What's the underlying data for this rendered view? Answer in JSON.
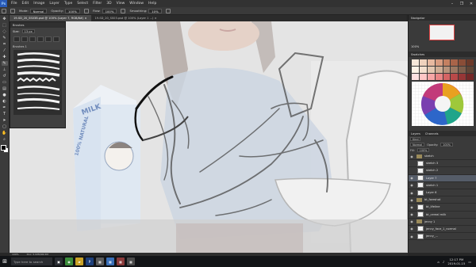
{
  "app": {
    "menu": [
      "File",
      "Edit",
      "Image",
      "Layer",
      "Type",
      "Select",
      "Filter",
      "3D",
      "View",
      "Window",
      "Help"
    ],
    "window_controls": [
      "–",
      "❐",
      "✕"
    ]
  },
  "options_bar": {
    "mode_label": "Mode:",
    "mode_value": "Normal",
    "opacity_label": "Opacity:",
    "opacity_value": "100%",
    "flow_label": "Flow:",
    "flow_value": "100%",
    "smoothing_label": "Smoothing:",
    "smoothing_value": "10%"
  },
  "tabs": [
    {
      "label": "19-SD_20_SS03B.psd @ 100% (Layer 7, RGB/8#) ×",
      "active": true
    },
    {
      "label": "19-SD_20_SS03.psd @ 100% (Layer 1 ...) ×",
      "active": false
    }
  ],
  "brush_panel": {
    "title": "Brushes",
    "size_label": "Size:",
    "size_value": "13 px",
    "group_label": "Brushes 1"
  },
  "navigator": {
    "title": "Navigator",
    "zoom": "100%"
  },
  "swatches": {
    "title": "Swatches",
    "colors": [
      "#f6e7d9",
      "#efd2bd",
      "#e7b9a0",
      "#d89c80",
      "#c48061",
      "#a96449",
      "#8a4d37",
      "#6c3a2a",
      "#fff2e6",
      "#f3dfce",
      "#e3c7b0",
      "#cfae95",
      "#b8937b",
      "#9c7862",
      "#7e5f4c",
      "#614636",
      "#ffe0e0",
      "#ffc6c6",
      "#f7a6a6",
      "#e98585",
      "#d56464",
      "#b94949",
      "#973636",
      "#742828"
    ]
  },
  "layers": {
    "tabs": [
      "Layers",
      "Channels"
    ],
    "kind_label": "Kind",
    "blend_mode": "Normal",
    "opacity_label": "Opacity:",
    "opacity_value": "100%",
    "fill_label": "Fill:",
    "fill_value": "100%",
    "rows": [
      {
        "name": "sketch",
        "type": "folder",
        "visible": true,
        "selected": false
      },
      {
        "name": "sketch 3",
        "type": "layer",
        "visible": false,
        "selected": false
      },
      {
        "name": "sketch 2",
        "type": "layer",
        "visible": false,
        "selected": false
      },
      {
        "name": "Layer 7",
        "type": "layer",
        "visible": true,
        "selected": true
      },
      {
        "name": "sketch 1",
        "type": "layer",
        "visible": true,
        "selected": false
      },
      {
        "name": "Layer 6",
        "type": "layer",
        "visible": true,
        "selected": false
      },
      {
        "name": "bt_foreshot",
        "type": "folder",
        "visible": true,
        "selected": false
      },
      {
        "name": "bt_lifeline",
        "type": "layer",
        "visible": true,
        "selected": false
      },
      {
        "name": "bt_cereal milk",
        "type": "layer",
        "visible": true,
        "selected": false
      },
      {
        "name": "jenny 1",
        "type": "folder",
        "visible": true,
        "selected": false
      },
      {
        "name": "jenny_face_1_normal",
        "type": "layer",
        "visible": true,
        "selected": false
      },
      {
        "name": "jenny_...",
        "type": "layer",
        "visible": true,
        "selected": false
      }
    ]
  },
  "status": {
    "zoom": "100%",
    "doc": "Doc: 5.93M/96.5M"
  },
  "taskbar": {
    "search_placeholder": "Type here to search",
    "time": "12:17 PM",
    "date": "2019-01-15"
  },
  "artwork": {
    "carton_text_top": "MILK",
    "carton_text_main": "100% NATURAL"
  }
}
